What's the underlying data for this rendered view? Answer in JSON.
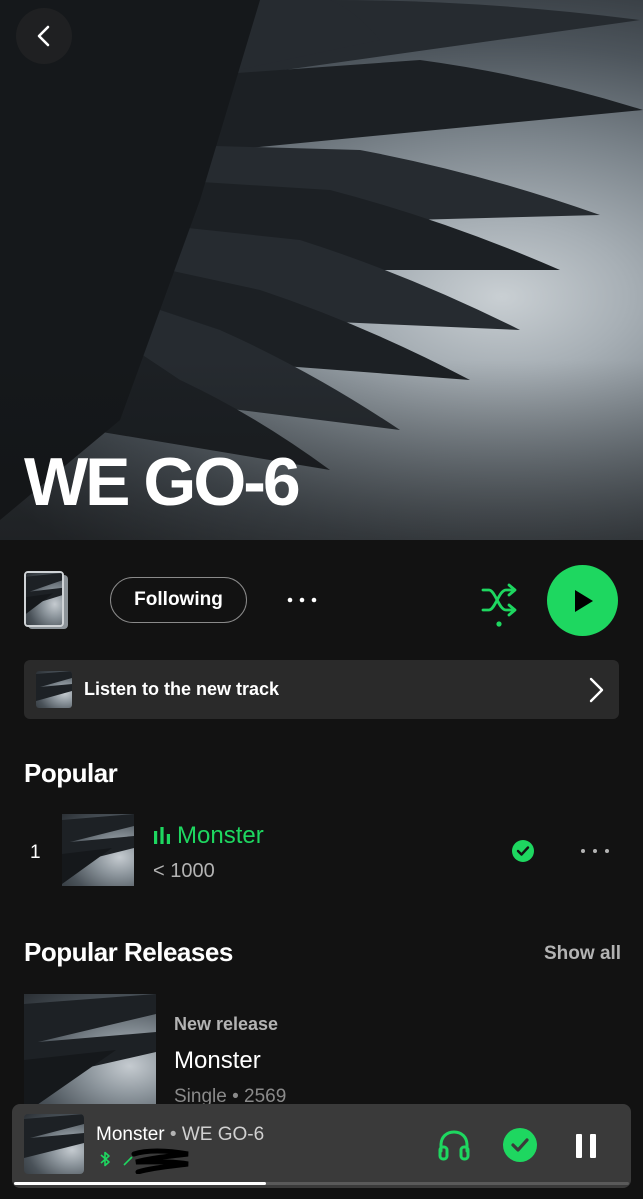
{
  "header": {
    "artist_name": "WE GO-6",
    "back_icon": "chevron-left-icon"
  },
  "controls": {
    "follow_label": "Following",
    "more_icon": "more-horizontal-icon",
    "shuffle_icon": "shuffle-icon",
    "play_icon": "play-icon",
    "accent_color": "#1ed760"
  },
  "new_track": {
    "label": "Listen to the new track",
    "chevron_icon": "chevron-right-icon"
  },
  "popular": {
    "title": "Popular",
    "tracks": [
      {
        "index": "1",
        "name": "Monster",
        "plays": "< 1000"
      }
    ]
  },
  "popular_releases": {
    "title": "Popular Releases",
    "show_all_label": "Show all",
    "items": [
      {
        "tag": "New release",
        "name": "Monster",
        "meta": "Single • 2569"
      }
    ]
  },
  "now_playing": {
    "title": "Monster",
    "separator": " • ",
    "artist": "WE GO-6",
    "connect_icon": "bluetooth-icon",
    "output_icon": "headphones-icon",
    "saved_icon": "check-icon",
    "pause_icon": "pause-icon",
    "progress": 0.41
  }
}
